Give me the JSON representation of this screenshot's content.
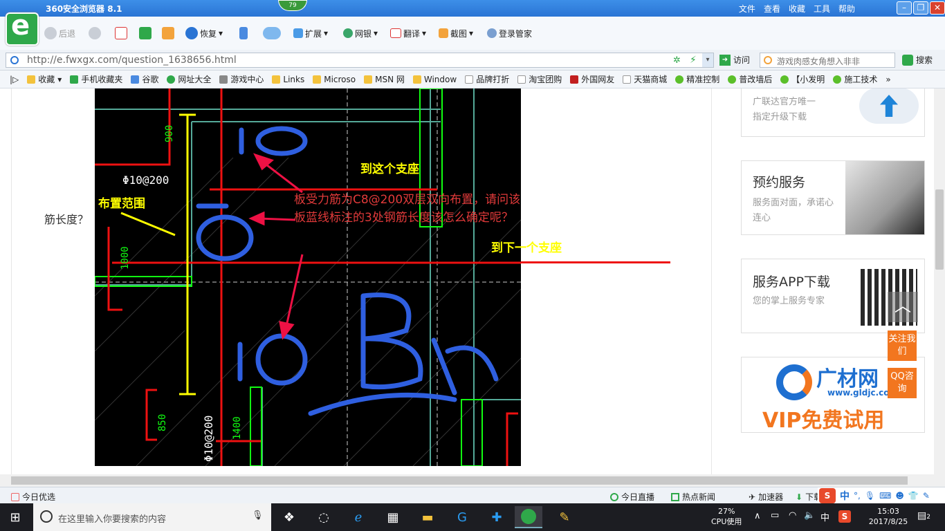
{
  "browser": {
    "title": "360安全浏览器 8.1",
    "badge": "79",
    "menu": [
      "文件",
      "查看",
      "收藏",
      "工具",
      "帮助"
    ],
    "logo_letter": "e"
  },
  "toolbar": {
    "back": "后退",
    "restore": "恢复",
    "extend": "扩展",
    "bank": "网银",
    "translate": "翻译",
    "screenshot": "截图",
    "login_manager": "登录管家"
  },
  "address": {
    "url": "http://e.fwxgx.com/question_1638656.html",
    "go": "访问",
    "search_placeholder": "游戏肉感女角想入非非",
    "search_button": "搜索"
  },
  "bookmarks": [
    "收藏",
    "手机收藏夹",
    "谷歌",
    "网址大全",
    "游戏中心",
    "Links",
    "Microso",
    "MSN 网",
    "Window",
    "品牌打折",
    "淘宝团购",
    "外国网友",
    "天猫商城",
    "精准控制",
    "普改墙后",
    "【小发明",
    "施工技术"
  ],
  "page": {
    "question_fragment": "筋长度？",
    "drawing": {
      "label_range": "布置范围",
      "label_to_this": "到这个支座",
      "label_to_next": "到下一个支座",
      "question": "板受力筋为C8@200双层双向布置，请问该板蓝线标注的3处钢筋长度该怎么确定呢？",
      "rebar_top": "Φ10@200",
      "rebar_bottom": "Φ10@200",
      "dims": [
        "900",
        "1000",
        "850",
        "1400"
      ],
      "blue_marks": [
        "1①",
        "②",
        "1③",
        "B板"
      ]
    }
  },
  "sidebar": {
    "card1": {
      "line1": "广联达官方唯一",
      "line2": "指定升级下载"
    },
    "card2": {
      "title": "预约服务",
      "desc": "服务面对面，承诺心连心"
    },
    "card3": {
      "title": "服务APP下载",
      "desc": "您的掌上服务专家"
    },
    "card4": {
      "brand": "广材网",
      "site": "www.gldjc.com",
      "promo": "VIP免费试用"
    },
    "follow": "关注我们",
    "qq": "QQ咨询"
  },
  "status": {
    "today_pick": "今日优选",
    "live": "今日直播",
    "hot_news": "热点新闻",
    "accelerator": "加速器",
    "download": "下载",
    "ime": "中"
  },
  "taskbar": {
    "search_placeholder": "在这里输入你要搜索的内容",
    "cpu_percent": "27%",
    "cpu_label": "CPU使用",
    "lang": "中",
    "time": "15:03",
    "date": "2017/8/25",
    "notif_count": "2"
  },
  "colors": {
    "accent": "#2a74d4",
    "orange": "#f2761f",
    "cad_bg": "#000000"
  }
}
